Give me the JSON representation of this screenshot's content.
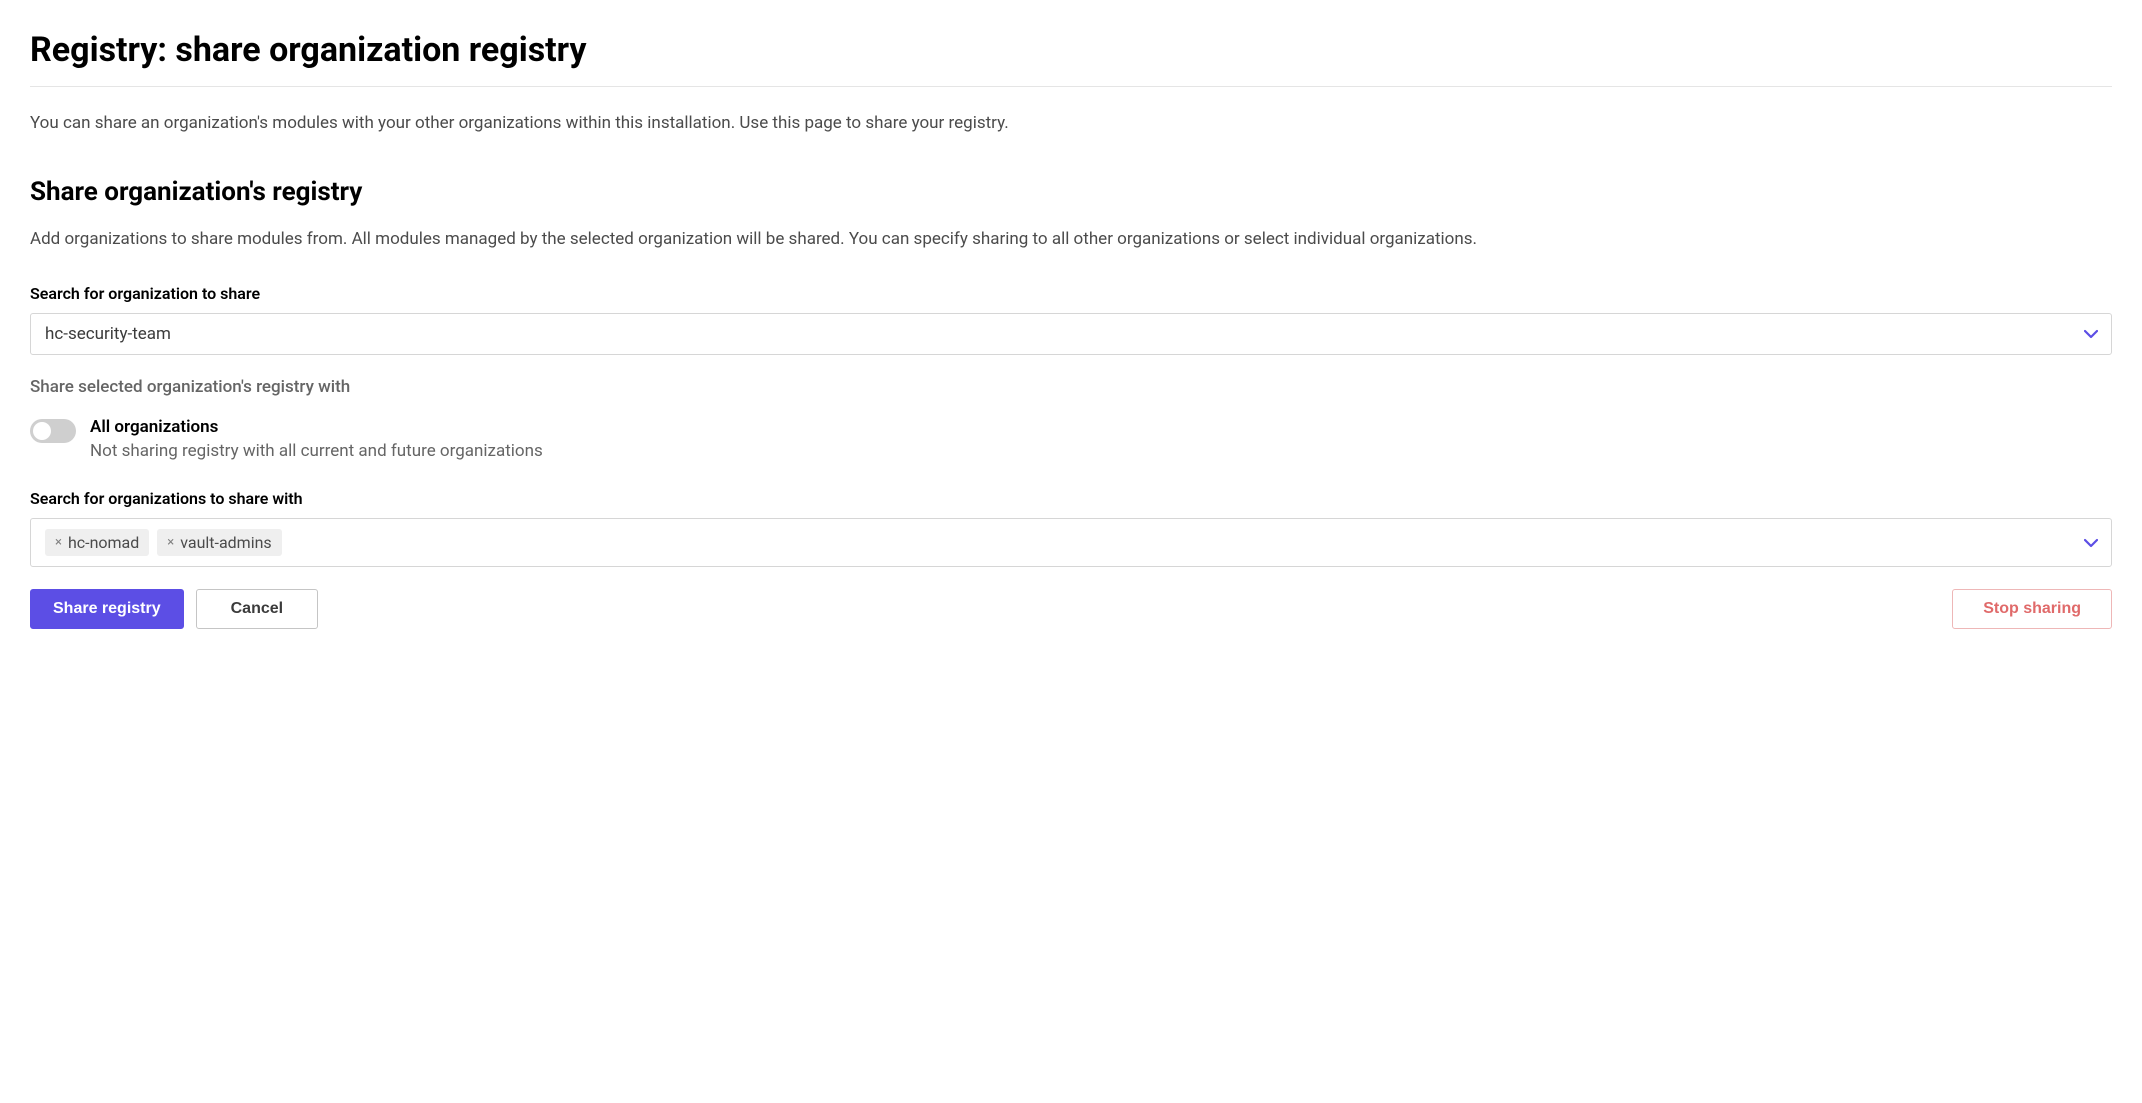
{
  "page": {
    "title": "Registry: share organization registry",
    "description": "You can share an organization's modules with your other organizations within this installation. Use this page to share your registry."
  },
  "section": {
    "heading": "Share organization's registry",
    "description": "Add organizations to share modules from. All modules managed by the selected organization will be shared. You can specify sharing to all other organizations or select individual organizations."
  },
  "source_org": {
    "label": "Search for organization to share",
    "value": "hc-security-team"
  },
  "share_with_label": "Share selected organization's registry with",
  "toggle": {
    "title": "All organizations",
    "subtitle": "Not sharing registry with all current and future organizations",
    "enabled": false
  },
  "target_orgs": {
    "label": "Search for organizations to share with",
    "tags": [
      "hc-nomad",
      "vault-admins"
    ]
  },
  "buttons": {
    "primary": "Share registry",
    "cancel": "Cancel",
    "stop": "Stop sharing"
  },
  "colors": {
    "accent": "#5c4ee5",
    "danger_text": "#e06a6a",
    "danger_border": "#eeb7b7"
  }
}
